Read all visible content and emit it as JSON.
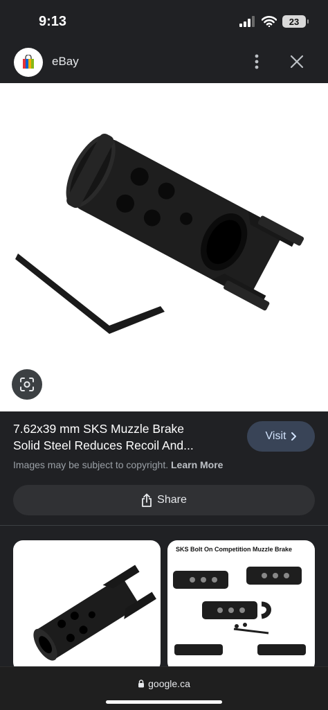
{
  "status_bar": {
    "time": "9:13",
    "battery": "23"
  },
  "header": {
    "site_name": "eBay"
  },
  "result": {
    "title_line1": "7.62x39 mm SKS Muzzle Brake",
    "title_line2": "Solid Steel Reduces Recoil And...",
    "visit_label": "Visit",
    "copyright_text": "Images may be subject to copyright. ",
    "learn_more": "Learn More",
    "share_label": "Share"
  },
  "related": [
    {
      "caption": ""
    },
    {
      "caption": "SKS  Bolt On Competition Muzzle Brake"
    }
  ],
  "browser": {
    "url": "google.ca"
  },
  "icons": {
    "favicon": "ebay-bag-icon",
    "more": "more-vert-icon",
    "close": "close-icon",
    "lens": "google-lens-icon",
    "visit": "chevron-right-icon",
    "share": "share-icon",
    "lock": "lock-icon"
  },
  "colors": {
    "background": "#202124",
    "visit_button": "#394457",
    "share_button": "#303134"
  }
}
